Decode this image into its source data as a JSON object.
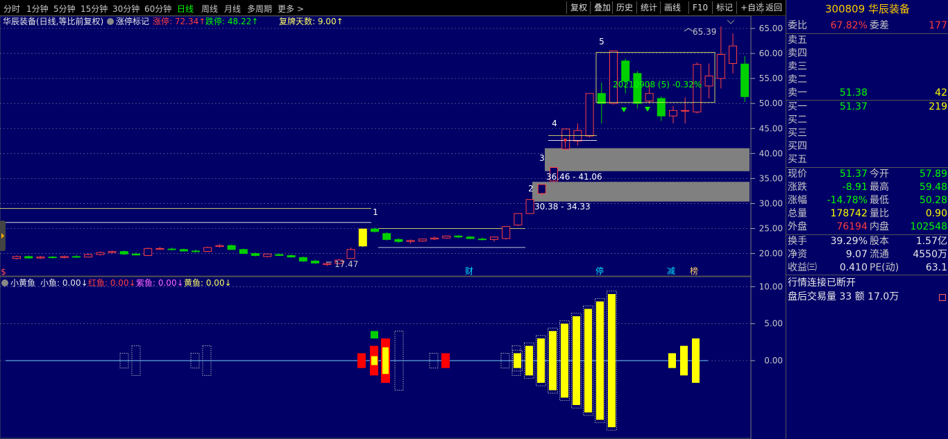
{
  "toolbar": {
    "periods": [
      "分时",
      "1分钟",
      "5分钟",
      "15分钟",
      "30分钟",
      "60分钟",
      "日线",
      "周线",
      "月线",
      "多周期",
      "更多 >"
    ],
    "active_period": "日线",
    "buttons": [
      "复权",
      "叠加",
      "历史",
      "统计",
      "画线",
      "F10",
      "标记",
      "+自选",
      "返回"
    ]
  },
  "main_header": {
    "stock_label": "华辰装备(日线,等比前复权)",
    "indicator": "涨停标记",
    "limit_up_label": "涨停: 72.34↑",
    "limit_down_label": "跌停: 48.22↑",
    "resume_days_label": "复牌天数: 9.00↑"
  },
  "sub_header": {
    "name": "小黄鱼",
    "small_fish": "小鱼: 0.00↓",
    "red_fish": "红鱼: 0.00↓",
    "purple_fish": "紫鱼: 0.00↓",
    "yellow_fish": "黄鱼: 0.00↓"
  },
  "chart_data": [
    {
      "type": "candlestick",
      "y_axis": {
        "ticks": [
          20,
          25,
          30,
          35,
          40,
          45,
          50,
          55,
          60,
          65
        ],
        "range": [
          15.5,
          67.5
        ],
        "labels": [
          "20.00",
          "25.00",
          "30.00",
          "35.00",
          "40.00",
          "45.00",
          "50.00",
          "55.00",
          "60.00",
          "65.00"
        ]
      },
      "grid": true,
      "candles": [
        {
          "o": 19.0,
          "h": 19.6,
          "l": 18.8,
          "c": 19.4
        },
        {
          "o": 19.4,
          "h": 19.6,
          "l": 19.0,
          "c": 19.1
        },
        {
          "o": 19.1,
          "h": 19.5,
          "l": 18.9,
          "c": 19.3
        },
        {
          "o": 19.3,
          "h": 19.5,
          "l": 19.0,
          "c": 19.2
        },
        {
          "o": 19.2,
          "h": 19.6,
          "l": 19.0,
          "c": 19.4
        },
        {
          "o": 19.4,
          "h": 19.7,
          "l": 19.1,
          "c": 19.3
        },
        {
          "o": 19.3,
          "h": 20.0,
          "l": 19.2,
          "c": 19.8
        },
        {
          "o": 19.8,
          "h": 20.4,
          "l": 19.6,
          "c": 20.2
        },
        {
          "o": 20.2,
          "h": 20.6,
          "l": 20.0,
          "c": 20.4
        },
        {
          "o": 20.4,
          "h": 20.6,
          "l": 19.7,
          "c": 19.9
        },
        {
          "o": 19.9,
          "h": 20.2,
          "l": 19.6,
          "c": 19.7
        },
        {
          "o": 19.6,
          "h": 21.2,
          "l": 19.5,
          "c": 21.0
        },
        {
          "o": 21.0,
          "h": 21.3,
          "l": 20.8,
          "c": 21.0
        },
        {
          "o": 20.9,
          "h": 21.2,
          "l": 20.6,
          "c": 20.8
        },
        {
          "o": 20.8,
          "h": 21.0,
          "l": 20.4,
          "c": 20.5
        },
        {
          "o": 20.5,
          "h": 20.8,
          "l": 20.2,
          "c": 20.4
        },
        {
          "o": 20.4,
          "h": 21.4,
          "l": 20.3,
          "c": 21.2
        },
        {
          "o": 21.4,
          "h": 21.9,
          "l": 21.2,
          "c": 21.6
        },
        {
          "o": 21.6,
          "h": 21.8,
          "l": 20.7,
          "c": 20.8
        },
        {
          "o": 20.8,
          "h": 21.0,
          "l": 19.9,
          "c": 20.0
        },
        {
          "o": 20.0,
          "h": 20.2,
          "l": 19.4,
          "c": 19.6
        },
        {
          "o": 19.4,
          "h": 20.0,
          "l": 19.2,
          "c": 19.9
        },
        {
          "o": 19.8,
          "h": 20.0,
          "l": 19.5,
          "c": 19.6
        },
        {
          "o": 19.6,
          "h": 19.8,
          "l": 19.2,
          "c": 19.3
        },
        {
          "o": 19.2,
          "h": 19.4,
          "l": 18.3,
          "c": 18.5
        },
        {
          "o": 18.5,
          "h": 18.8,
          "l": 17.9,
          "c": 18.1
        },
        {
          "o": 17.8,
          "h": 18.3,
          "l": 17.47,
          "c": 18.0
        },
        {
          "o": 18.0,
          "h": 18.9,
          "l": 17.9,
          "c": 18.7
        },
        {
          "o": 19.0,
          "h": 21.2,
          "l": 18.9,
          "c": 20.8
        },
        {
          "o": 21.5,
          "h": 24.9,
          "l": 21.3,
          "c": 24.9
        },
        {
          "o": 24.9,
          "h": 25.2,
          "l": 24.2,
          "c": 24.4
        },
        {
          "o": 24.0,
          "h": 24.3,
          "l": 22.6,
          "c": 22.8
        },
        {
          "o": 22.8,
          "h": 23.1,
          "l": 22.1,
          "c": 22.4
        },
        {
          "o": 22.4,
          "h": 22.8,
          "l": 22.0,
          "c": 22.6
        },
        {
          "o": 22.5,
          "h": 23.0,
          "l": 22.3,
          "c": 22.9
        },
        {
          "o": 22.9,
          "h": 23.4,
          "l": 22.7,
          "c": 23.1
        },
        {
          "o": 23.1,
          "h": 23.6,
          "l": 23.0,
          "c": 23.5
        },
        {
          "o": 23.5,
          "h": 23.7,
          "l": 23.1,
          "c": 23.3
        },
        {
          "o": 23.3,
          "h": 23.5,
          "l": 22.9,
          "c": 23.0
        },
        {
          "o": 22.9,
          "h": 23.2,
          "l": 22.6,
          "c": 22.8
        },
        {
          "o": 22.8,
          "h": 23.4,
          "l": 22.4,
          "c": 23.3
        },
        {
          "o": 23.0,
          "h": 25.5,
          "l": 22.8,
          "c": 25.4
        },
        {
          "o": 25.7,
          "h": 28.0,
          "l": 25.5,
          "c": 28.0
        },
        {
          "o": 28.0,
          "h": 30.8,
          "l": 27.9,
          "c": 30.8
        },
        {
          "o": 32.0,
          "h": 33.8,
          "l": 31.6,
          "c": 33.8
        },
        {
          "o": 34.5,
          "h": 37.2,
          "l": 34.2,
          "c": 37.2
        },
        {
          "o": 40.9,
          "h": 44.9,
          "l": 40.6,
          "c": 44.9
        },
        {
          "o": 42.5,
          "h": 46.0,
          "l": 41.6,
          "c": 44.6
        },
        {
          "o": 43.5,
          "h": 52.0,
          "l": 43.2,
          "c": 52.0
        },
        {
          "o": 52.0,
          "h": 54.2,
          "l": 46.0,
          "c": 50.0
        },
        {
          "o": 50.0,
          "h": 60.5,
          "l": 49.8,
          "c": 60.5
        },
        {
          "o": 58.5,
          "h": 59.0,
          "l": 52.0,
          "c": 54.5
        },
        {
          "o": 56.0,
          "h": 56.5,
          "l": 49.0,
          "c": 50.0
        },
        {
          "o": 50.5,
          "h": 54.0,
          "l": 50.0,
          "c": 52.0
        },
        {
          "o": 51.0,
          "h": 51.4,
          "l": 46.5,
          "c": 47.5
        },
        {
          "o": 47.5,
          "h": 49.5,
          "l": 46.0,
          "c": 48.6
        },
        {
          "o": 48.5,
          "h": 51.2,
          "l": 46.0,
          "c": 48.6
        },
        {
          "o": 48.3,
          "h": 58.2,
          "l": 48.0,
          "c": 57.8
        },
        {
          "o": 53.5,
          "h": 58.0,
          "l": 51.0,
          "c": 55.5
        },
        {
          "o": 55.0,
          "h": 65.39,
          "l": 53.0,
          "c": 59.8
        },
        {
          "o": 58.0,
          "h": 64.0,
          "l": 56.0,
          "c": 61.5
        },
        {
          "o": 57.89,
          "h": 59.48,
          "l": 50.28,
          "c": 51.37
        }
      ],
      "marks": [
        "1",
        "2",
        "3",
        "4",
        "5"
      ],
      "annotations": [
        "65.39",
        "17.47",
        "36.46 - 41.06",
        "30.38 - 34.33",
        "20210908 (5) -0.32%"
      ],
      "gaps": [
        {
          "from": 36.46,
          "to": 41.06
        },
        {
          "from": 30.38,
          "to": 34.33
        }
      ],
      "ref_lines": [
        29.0,
        26.2,
        25.0,
        21.2
      ],
      "event_flags": [
        "$",
        "财",
        "停",
        "减",
        "榜"
      ]
    },
    {
      "type": "bar",
      "y_axis": {
        "ticks": [
          0,
          5,
          10
        ],
        "range": [
          -10.5,
          10.5
        ],
        "labels": [
          "0.00",
          "5.00",
          "10.00"
        ]
      },
      "series": [
        {
          "values": [
            1,
            2,
            3,
            4,
            5,
            6,
            7,
            8,
            9
          ]
        },
        {
          "values": [
            1,
            2,
            3
          ]
        }
      ]
    }
  ],
  "quote": {
    "title": "300809 华辰装备",
    "weibi_label": "委比",
    "weibi": "67.82%",
    "weicha_label": "委差",
    "weicha": "177",
    "asks": [
      {
        "label": "卖五",
        "price": "",
        "vol": ""
      },
      {
        "label": "卖四",
        "price": "",
        "vol": ""
      },
      {
        "label": "卖三",
        "price": "",
        "vol": ""
      },
      {
        "label": "卖二",
        "price": "",
        "vol": ""
      },
      {
        "label": "卖一",
        "price": "51.38",
        "vol": "42"
      }
    ],
    "bids": [
      {
        "label": "买一",
        "price": "51.37",
        "vol": "219"
      },
      {
        "label": "买二",
        "price": "",
        "vol": ""
      },
      {
        "label": "买三",
        "price": "",
        "vol": ""
      },
      {
        "label": "买四",
        "price": "",
        "vol": ""
      },
      {
        "label": "买五",
        "price": "",
        "vol": ""
      }
    ],
    "stats": [
      {
        "l": "现价",
        "v": "51.37",
        "vc": "green",
        "l2": "今开",
        "v2": "57.89",
        "v2c": "green"
      },
      {
        "l": "涨跌",
        "v": "-8.91",
        "vc": "green",
        "l2": "最高",
        "v2": "59.48",
        "v2c": "green"
      },
      {
        "l": "涨幅",
        "v": "-14.78%",
        "vc": "green",
        "l2": "最低",
        "v2": "50.28",
        "v2c": "green"
      },
      {
        "l": "总量",
        "v": "178742",
        "vc": "yellow",
        "l2": "量比",
        "v2": "0.90",
        "v2c": "yellow"
      },
      {
        "l": "外盘",
        "v": "76194",
        "vc": "red",
        "l2": "内盘",
        "v2": "102548",
        "v2c": "green"
      }
    ],
    "stats2": [
      {
        "l": "换手",
        "v": "39.29%",
        "vc": "white",
        "l2": "股本",
        "v2": "1.57亿",
        "v2c": "white"
      },
      {
        "l": "净资",
        "v": "9.07",
        "vc": "white",
        "l2": "流通",
        "v2": "4550万",
        "v2c": "white"
      },
      {
        "l": "收益㈢",
        "v": "0.410",
        "vc": "white",
        "l2": "PE(动)",
        "v2": "63.1",
        "v2c": "white"
      }
    ],
    "status": "行情连接已断开",
    "after_hours": "盘后交易量 33 额 17.0万"
  }
}
